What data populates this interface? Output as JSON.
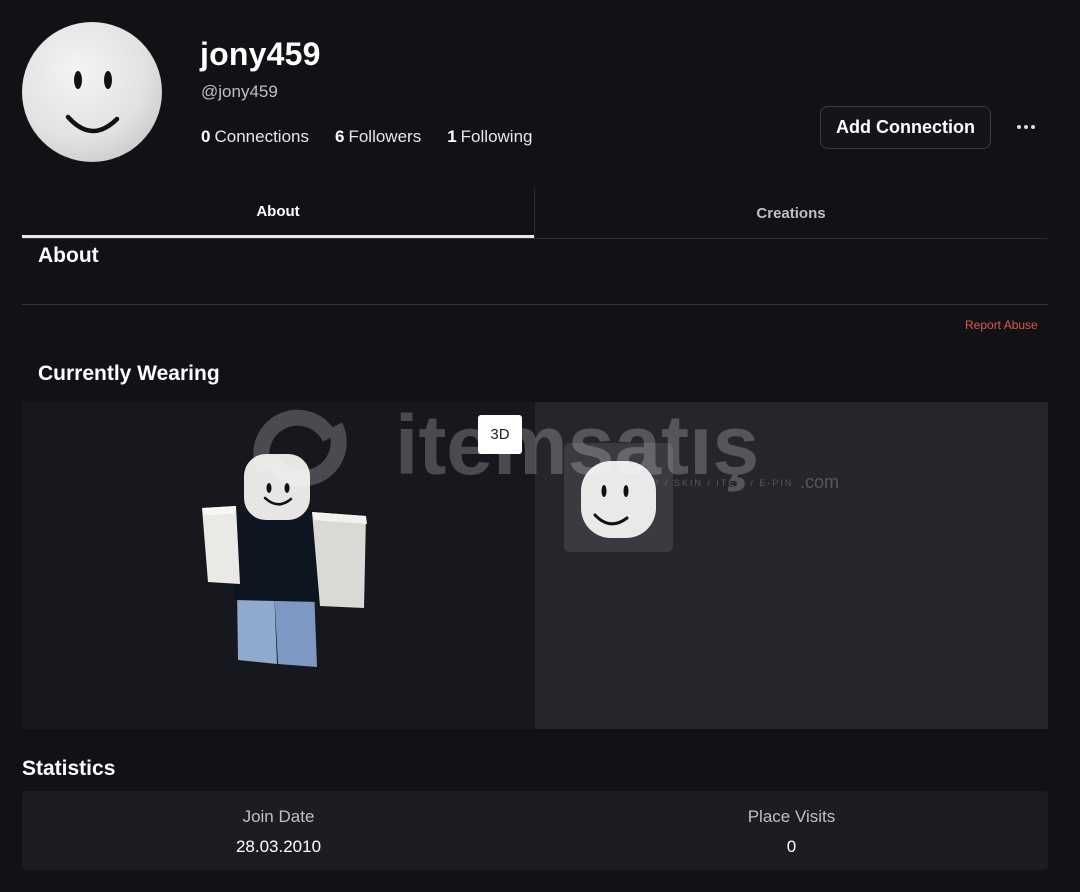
{
  "profile": {
    "display_name": "jony459",
    "handle": "@jony459",
    "connections_count": "0",
    "connections_label": "Connections",
    "followers_count": "6",
    "followers_label": "Followers",
    "following_count": "1",
    "following_label": "Following",
    "add_connection_label": "Add Connection",
    "more_icon": "ellipsis-icon"
  },
  "tabs": [
    {
      "label": "About",
      "active": true
    },
    {
      "label": "Creations",
      "active": false
    }
  ],
  "about": {
    "title": "About",
    "report_abuse_label": "Report Abuse"
  },
  "wearing": {
    "title": "Currently Wearing",
    "toggle_3d_label": "3D",
    "watermark_text": "itemsatış",
    "watermark_sub": "HESAP / SKIN / ITEM / E-PIN",
    "watermark_domain": ".com"
  },
  "statistics": {
    "title": "Statistics",
    "items": [
      {
        "label": "Join Date",
        "value": "28.03.2010"
      },
      {
        "label": "Place Visits",
        "value": "0"
      }
    ]
  },
  "colors": {
    "background": "#111216",
    "panel_dark": "#17181d",
    "panel_light": "#25262c",
    "report_abuse": "#e0574b"
  }
}
